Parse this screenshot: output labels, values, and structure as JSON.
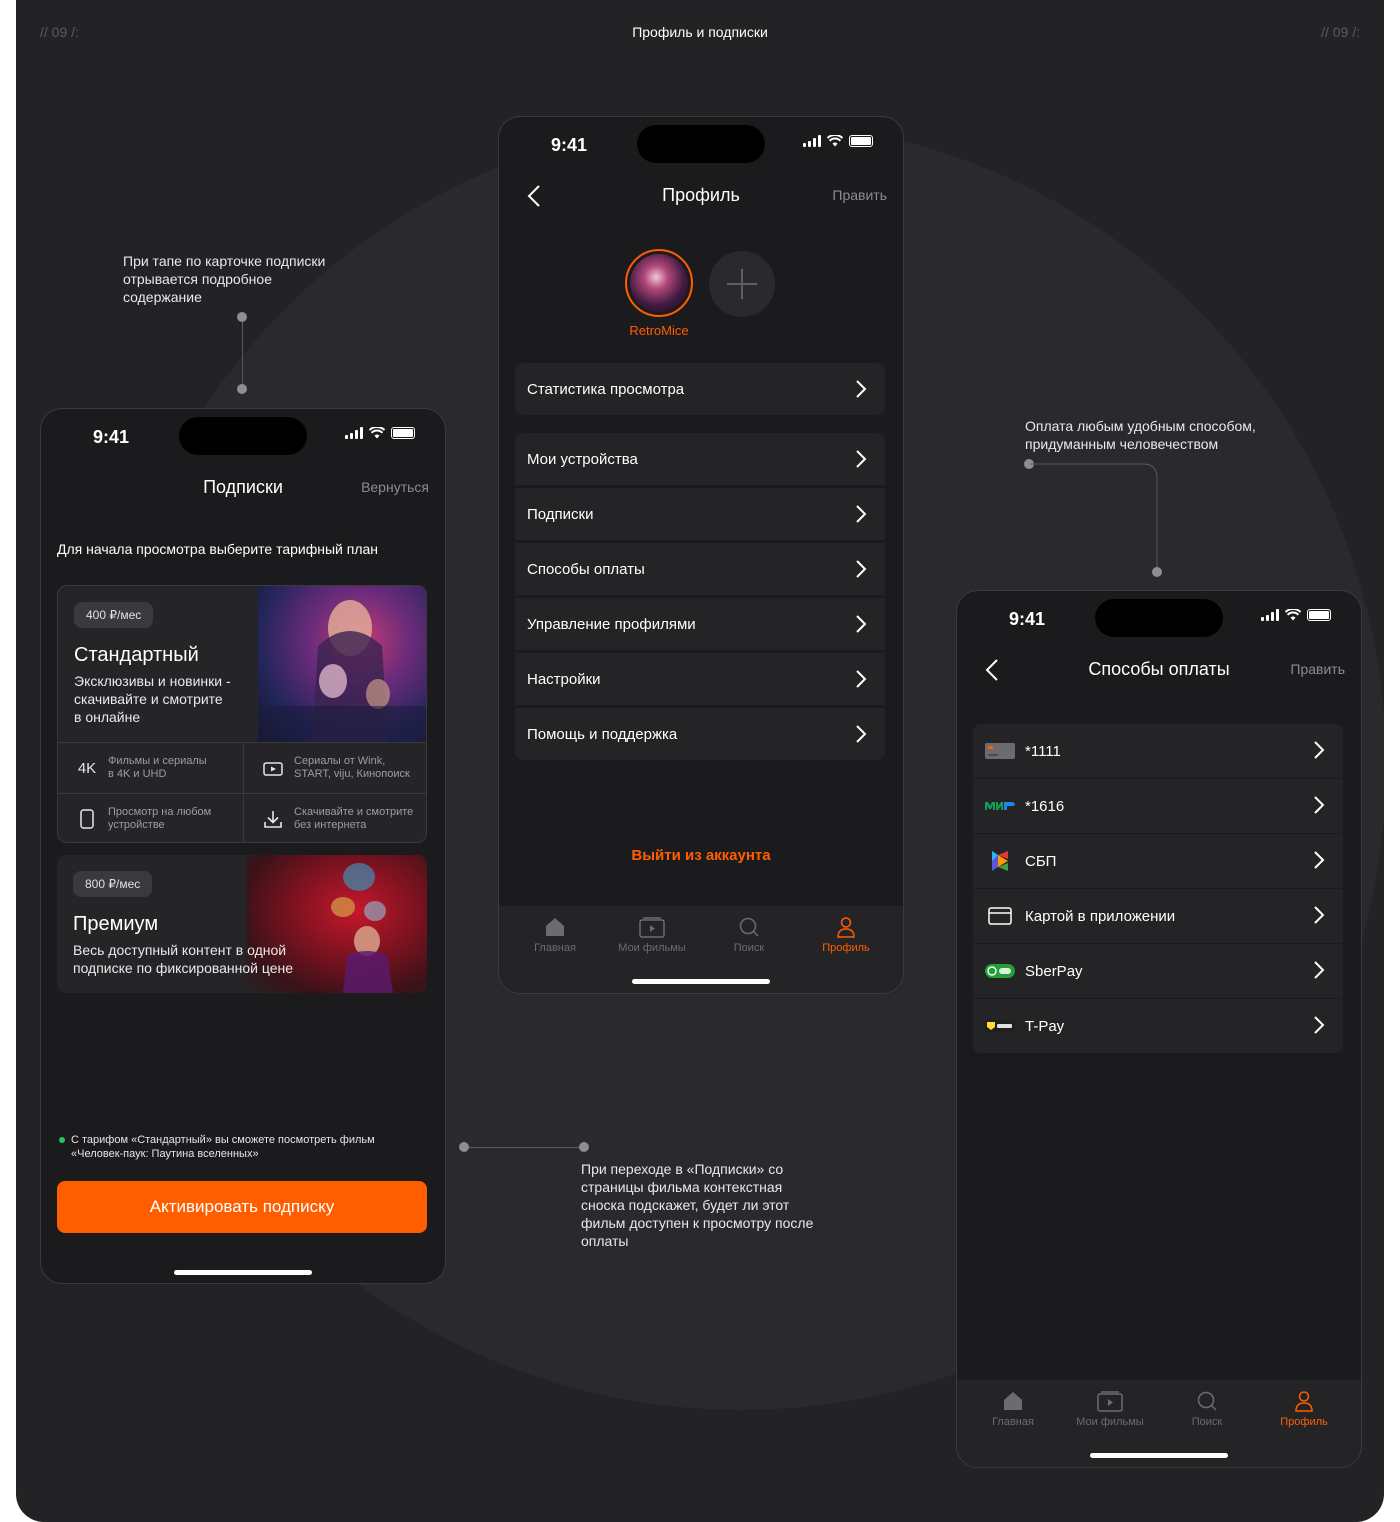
{
  "header": {
    "left": "// 09 /:",
    "center": "Профиль и подписки",
    "right": "// 09 /:"
  },
  "notes": {
    "top_left": "При тапе по карточке подписки\nотрывается подробное\nсодержание",
    "right": "Оплата любым удобным способом,\nпридуманным человечеством",
    "bottom": "При переходе в «Подписки» со\nстраницы фильма контекстная\nсноска подскажет, будет ли этот\nфильм доступен к просмотру после\nоплаты"
  },
  "status": {
    "time": "9:41"
  },
  "subscriptions": {
    "title": "Подписки",
    "back_label": "Вернуться",
    "intro": "Для начала просмотра выберите тарифный план",
    "standard": {
      "price": "400 ₽/мес",
      "name": "Стандартный",
      "desc": "Эксклюзивы и новинки -\nскачивайте и смотрите\nв онлайне",
      "features": [
        {
          "icon": "4k-icon",
          "glyph": "4K",
          "text": "Фильмы и сериалы\nв 4K и UHD"
        },
        {
          "icon": "tv-play-icon",
          "text": "Сериалы от Wink,\nSTART, viju, Кинопоиск"
        },
        {
          "icon": "phone-icon",
          "text": "Просмотр на любом\nустройстве"
        },
        {
          "icon": "download-icon",
          "text": "Скачивайте и смотрите\nбез интернета"
        }
      ]
    },
    "premium": {
      "price": "800 ₽/мес",
      "name": "Премиум",
      "desc": "Весь доступный контент в одной\nподписке по фиксированной цене"
    },
    "hint": "С тарифом «Стандартный» вы сможете посмотреть фильм\n«Человек-паук: Паутина вселенных»",
    "cta": "Активировать подписку"
  },
  "profile": {
    "title": "Профиль",
    "edit_label": "Править",
    "username": "RetroMice",
    "rows": [
      "Статистика просмотра",
      "Мои устройства",
      "Подписки",
      "Способы оплаты",
      "Управление профилями",
      "Настройки",
      "Помощь и поддержка"
    ],
    "logout": "Выйти из аккаунта"
  },
  "tabbar": {
    "tabs": [
      {
        "label": "Главная",
        "icon": "home-icon"
      },
      {
        "label": "Мои фильмы",
        "icon": "my-films-icon"
      },
      {
        "label": "Поиск",
        "icon": "search-icon"
      },
      {
        "label": "Профиль",
        "icon": "profile-icon"
      }
    ],
    "active": "Профиль"
  },
  "payment": {
    "title": "Способы оплаты",
    "edit_label": "Править",
    "methods": [
      {
        "label": "*1111",
        "icon": "bank-card-icon"
      },
      {
        "label": "*1616",
        "icon": "mir-logo-icon"
      },
      {
        "label": "СБП",
        "icon": "sbp-logo-icon"
      },
      {
        "label": "Картой в приложении",
        "icon": "card-outline-icon"
      },
      {
        "label": "SberPay",
        "icon": "sberpay-logo-icon"
      },
      {
        "label": "T-Pay",
        "icon": "tpay-logo-icon"
      }
    ]
  },
  "colors": {
    "accent": "#ff5e00",
    "background": "#232325",
    "phone": "#1b1b1d",
    "row": "#242427",
    "hint_dot": "#22c55e"
  }
}
